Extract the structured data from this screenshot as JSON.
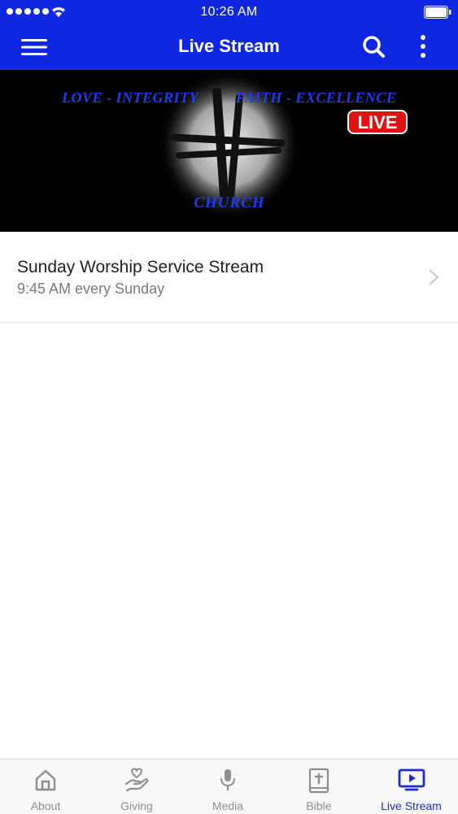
{
  "status": {
    "time": "10:26 AM"
  },
  "nav": {
    "title": "Live Stream"
  },
  "banner": {
    "top_text_left": "LOVE - INTEGRITY",
    "top_text_right": "FAITH - EXCELLENCE",
    "live_badge": "LIVE",
    "bottom_text": "CHURCH"
  },
  "stream": {
    "title": "Sunday Worship Service Stream",
    "schedule": "9:45 AM every Sunday"
  },
  "tabs": [
    {
      "label": "About",
      "icon": "home-icon"
    },
    {
      "label": "Giving",
      "icon": "giving-hand-icon"
    },
    {
      "label": "Media",
      "icon": "microphone-icon"
    },
    {
      "label": "Bible",
      "icon": "bible-icon"
    },
    {
      "label": "Live Stream",
      "icon": "tv-play-icon"
    }
  ],
  "colors": {
    "accent": "#0f27e0",
    "active_tab": "#1a2bd1",
    "live_red": "#e01212"
  }
}
